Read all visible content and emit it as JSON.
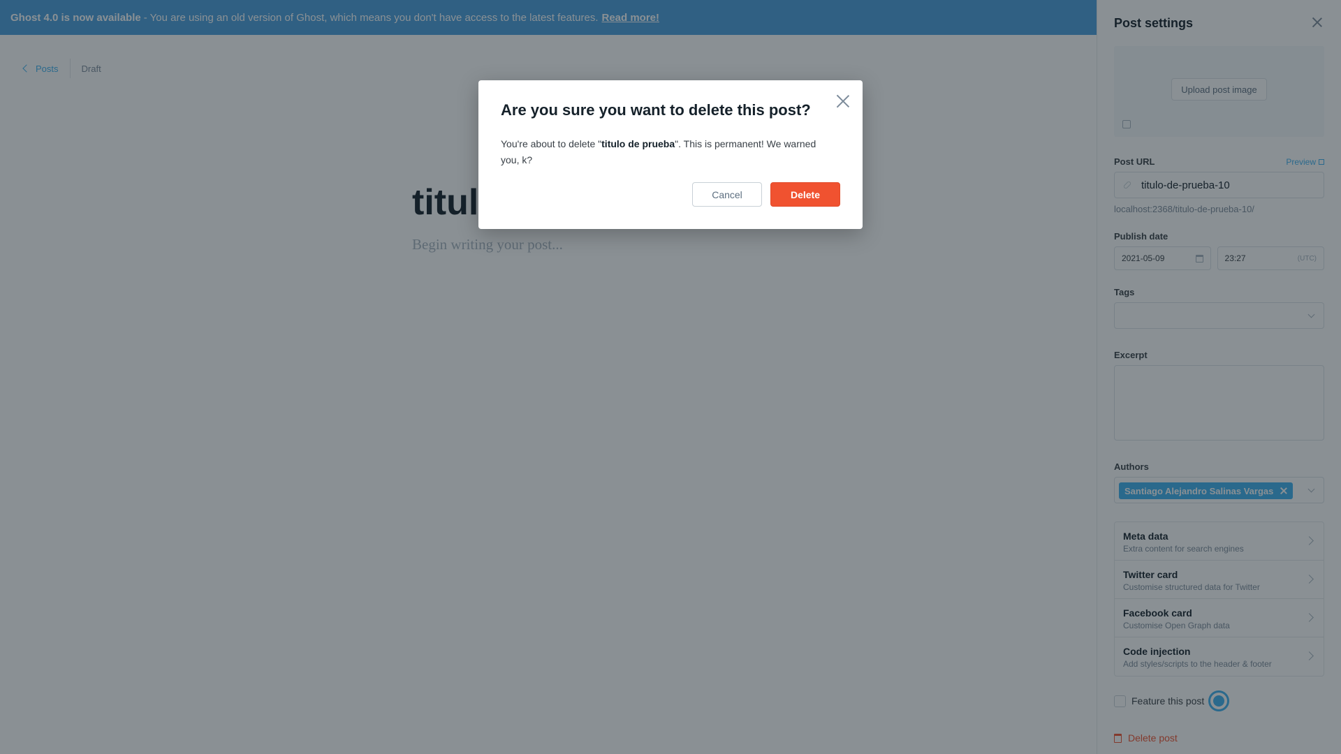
{
  "banner": {
    "strong": "Ghost 4.0 is now available",
    "text": " - You are using an old version of Ghost, which means you don't have access to the latest features.",
    "link": "Read more!"
  },
  "editor": {
    "back_label": "Posts",
    "status": "Draft",
    "title": "titulo de prueba",
    "body_placeholder": "Begin writing your post..."
  },
  "settings": {
    "title": "Post settings",
    "upload_label": "Upload post image",
    "post_url": {
      "label": "Post URL",
      "preview_label": "Preview",
      "value": "titulo-de-prueba-10",
      "hint": "localhost:2368/titulo-de-prueba-10/"
    },
    "publish": {
      "label": "Publish date",
      "date": "2021-05-09",
      "time": "23:27",
      "tz": "(UTC)"
    },
    "tags_label": "Tags",
    "excerpt_label": "Excerpt",
    "authors": {
      "label": "Authors",
      "chip": "Santiago Alejandro Salinas Vargas"
    },
    "nav_items": [
      {
        "title": "Meta data",
        "sub": "Extra content for search engines"
      },
      {
        "title": "Twitter card",
        "sub": "Customise structured data for Twitter"
      },
      {
        "title": "Facebook card",
        "sub": "Customise Open Graph data"
      },
      {
        "title": "Code injection",
        "sub": "Add styles/scripts to the header & footer"
      }
    ],
    "feature_label": "Feature this post",
    "delete_label": "Delete post"
  },
  "modal": {
    "title": "Are you sure you want to delete this post?",
    "text_before": "You're about to delete \"",
    "post_name": "titulo de prueba",
    "text_after": "\". This is permanent! We warned you, k?",
    "cancel_label": "Cancel",
    "delete_label": "Delete"
  },
  "colors": {
    "accent": "#3eb0ef",
    "danger": "#f05230",
    "banner": "#4a9fdc"
  }
}
